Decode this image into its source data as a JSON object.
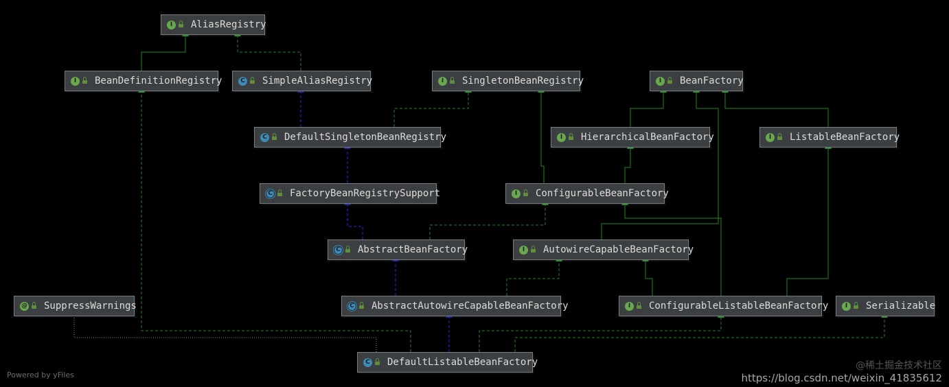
{
  "colors": {
    "implements_edge": "#1d8a1d",
    "extends_edge": "#1b1b9c",
    "annotation_edge": "#8a8a8a",
    "interface_badge": "#6aa84f",
    "class_badge": "#3d8ab8",
    "abstract_class_badge": "#3d8ab8",
    "annotation_badge": "#6aa84f",
    "node_bg": "#3c3f41"
  },
  "nodes": [
    {
      "id": "AliasRegistry",
      "label": "AliasRegistry",
      "kind": "interface",
      "icon": "interface-icon"
    },
    {
      "id": "BeanDefinitionRegistry",
      "label": "BeanDefinitionRegistry",
      "kind": "interface",
      "icon": "interface-icon"
    },
    {
      "id": "SimpleAliasRegistry",
      "label": "SimpleAliasRegistry",
      "kind": "class",
      "icon": "class-icon"
    },
    {
      "id": "SingletonBeanRegistry",
      "label": "SingletonBeanRegistry",
      "kind": "interface",
      "icon": "interface-icon"
    },
    {
      "id": "BeanFactory",
      "label": "BeanFactory",
      "kind": "interface",
      "icon": "interface-icon"
    },
    {
      "id": "DefaultSingletonBeanRegistry",
      "label": "DefaultSingletonBeanRegistry",
      "kind": "class",
      "icon": "class-icon"
    },
    {
      "id": "HierarchicalBeanFactory",
      "label": "HierarchicalBeanFactory",
      "kind": "interface",
      "icon": "interface-icon"
    },
    {
      "id": "ListableBeanFactory",
      "label": "ListableBeanFactory",
      "kind": "interface",
      "icon": "interface-icon"
    },
    {
      "id": "FactoryBeanRegistrySupport",
      "label": "FactoryBeanRegistrySupport",
      "kind": "abstract",
      "icon": "abstract-class-icon"
    },
    {
      "id": "ConfigurableBeanFactory",
      "label": "ConfigurableBeanFactory",
      "kind": "interface",
      "icon": "interface-icon"
    },
    {
      "id": "AbstractBeanFactory",
      "label": "AbstractBeanFactory",
      "kind": "abstract",
      "icon": "abstract-class-icon"
    },
    {
      "id": "AutowireCapableBeanFactory",
      "label": "AutowireCapableBeanFactory",
      "kind": "interface",
      "icon": "interface-icon"
    },
    {
      "id": "SuppressWarnings",
      "label": "SuppressWarnings",
      "kind": "annotation",
      "icon": "annotation-icon"
    },
    {
      "id": "AbstractAutowireCapableBeanFactory",
      "label": "AbstractAutowireCapableBeanFactory",
      "kind": "abstract",
      "icon": "abstract-class-icon"
    },
    {
      "id": "ConfigurableListableBeanFactory",
      "label": "ConfigurableListableBeanFactory",
      "kind": "interface",
      "icon": "interface-icon"
    },
    {
      "id": "Serializable",
      "label": "Serializable",
      "kind": "interface",
      "icon": "interface-icon"
    },
    {
      "id": "DefaultListableBeanFactory",
      "label": "DefaultListableBeanFactory",
      "kind": "class",
      "icon": "class-icon"
    }
  ],
  "badges": {
    "interface": "I",
    "class": "C",
    "abstract": "C",
    "annotation": "@"
  },
  "edges": [
    {
      "from": "BeanDefinitionRegistry",
      "to": "AliasRegistry",
      "type": "extends-interface"
    },
    {
      "from": "SimpleAliasRegistry",
      "to": "AliasRegistry",
      "type": "implements"
    },
    {
      "from": "DefaultSingletonBeanRegistry",
      "to": "SimpleAliasRegistry",
      "type": "extends"
    },
    {
      "from": "DefaultSingletonBeanRegistry",
      "to": "SingletonBeanRegistry",
      "type": "implements"
    },
    {
      "from": "FactoryBeanRegistrySupport",
      "to": "DefaultSingletonBeanRegistry",
      "type": "extends"
    },
    {
      "from": "AbstractBeanFactory",
      "to": "FactoryBeanRegistrySupport",
      "type": "extends"
    },
    {
      "from": "AbstractBeanFactory",
      "to": "ConfigurableBeanFactory",
      "type": "implements"
    },
    {
      "from": "HierarchicalBeanFactory",
      "to": "BeanFactory",
      "type": "extends-interface"
    },
    {
      "from": "ListableBeanFactory",
      "to": "BeanFactory",
      "type": "extends-interface"
    },
    {
      "from": "AutowireCapableBeanFactory",
      "to": "BeanFactory",
      "type": "extends-interface"
    },
    {
      "from": "ConfigurableBeanFactory",
      "to": "HierarchicalBeanFactory",
      "type": "extends-interface"
    },
    {
      "from": "ConfigurableBeanFactory",
      "to": "SingletonBeanRegistry",
      "type": "extends-interface"
    },
    {
      "from": "AbstractAutowireCapableBeanFactory",
      "to": "AbstractBeanFactory",
      "type": "extends"
    },
    {
      "from": "AbstractAutowireCapableBeanFactory",
      "to": "AutowireCapableBeanFactory",
      "type": "implements"
    },
    {
      "from": "ConfigurableListableBeanFactory",
      "to": "ListableBeanFactory",
      "type": "extends-interface"
    },
    {
      "from": "ConfigurableListableBeanFactory",
      "to": "AutowireCapableBeanFactory",
      "type": "extends-interface"
    },
    {
      "from": "ConfigurableListableBeanFactory",
      "to": "ConfigurableBeanFactory",
      "type": "extends-interface"
    },
    {
      "from": "DefaultListableBeanFactory",
      "to": "AbstractAutowireCapableBeanFactory",
      "type": "extends"
    },
    {
      "from": "DefaultListableBeanFactory",
      "to": "ConfigurableListableBeanFactory",
      "type": "implements"
    },
    {
      "from": "DefaultListableBeanFactory",
      "to": "BeanDefinitionRegistry",
      "type": "implements"
    },
    {
      "from": "DefaultListableBeanFactory",
      "to": "Serializable",
      "type": "implements"
    },
    {
      "from": "DefaultListableBeanFactory",
      "to": "SuppressWarnings",
      "type": "annotated"
    }
  ],
  "footer": {
    "powered_by": "Powered by yFiles",
    "watermark_line1": "@稀土掘金技术社区",
    "watermark_line2": "https://blog.csdn.net/weixin_41835612"
  }
}
